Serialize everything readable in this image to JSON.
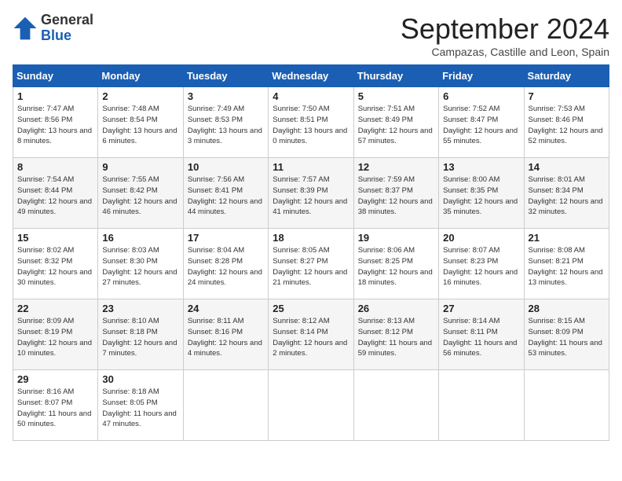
{
  "header": {
    "logo_general": "General",
    "logo_blue": "Blue",
    "month_title": "September 2024",
    "location": "Campazas, Castille and Leon, Spain"
  },
  "calendar": {
    "days_of_week": [
      "Sunday",
      "Monday",
      "Tuesday",
      "Wednesday",
      "Thursday",
      "Friday",
      "Saturday"
    ],
    "weeks": [
      [
        {
          "day": "1",
          "sunrise": "7:47 AM",
          "sunset": "8:56 PM",
          "daylight": "13 hours and 8 minutes."
        },
        {
          "day": "2",
          "sunrise": "7:48 AM",
          "sunset": "8:54 PM",
          "daylight": "13 hours and 6 minutes."
        },
        {
          "day": "3",
          "sunrise": "7:49 AM",
          "sunset": "8:53 PM",
          "daylight": "13 hours and 3 minutes."
        },
        {
          "day": "4",
          "sunrise": "7:50 AM",
          "sunset": "8:51 PM",
          "daylight": "13 hours and 0 minutes."
        },
        {
          "day": "5",
          "sunrise": "7:51 AM",
          "sunset": "8:49 PM",
          "daylight": "12 hours and 57 minutes."
        },
        {
          "day": "6",
          "sunrise": "7:52 AM",
          "sunset": "8:47 PM",
          "daylight": "12 hours and 55 minutes."
        },
        {
          "day": "7",
          "sunrise": "7:53 AM",
          "sunset": "8:46 PM",
          "daylight": "12 hours and 52 minutes."
        }
      ],
      [
        {
          "day": "8",
          "sunrise": "7:54 AM",
          "sunset": "8:44 PM",
          "daylight": "12 hours and 49 minutes."
        },
        {
          "day": "9",
          "sunrise": "7:55 AM",
          "sunset": "8:42 PM",
          "daylight": "12 hours and 46 minutes."
        },
        {
          "day": "10",
          "sunrise": "7:56 AM",
          "sunset": "8:41 PM",
          "daylight": "12 hours and 44 minutes."
        },
        {
          "day": "11",
          "sunrise": "7:57 AM",
          "sunset": "8:39 PM",
          "daylight": "12 hours and 41 minutes."
        },
        {
          "day": "12",
          "sunrise": "7:59 AM",
          "sunset": "8:37 PM",
          "daylight": "12 hours and 38 minutes."
        },
        {
          "day": "13",
          "sunrise": "8:00 AM",
          "sunset": "8:35 PM",
          "daylight": "12 hours and 35 minutes."
        },
        {
          "day": "14",
          "sunrise": "8:01 AM",
          "sunset": "8:34 PM",
          "daylight": "12 hours and 32 minutes."
        }
      ],
      [
        {
          "day": "15",
          "sunrise": "8:02 AM",
          "sunset": "8:32 PM",
          "daylight": "12 hours and 30 minutes."
        },
        {
          "day": "16",
          "sunrise": "8:03 AM",
          "sunset": "8:30 PM",
          "daylight": "12 hours and 27 minutes."
        },
        {
          "day": "17",
          "sunrise": "8:04 AM",
          "sunset": "8:28 PM",
          "daylight": "12 hours and 24 minutes."
        },
        {
          "day": "18",
          "sunrise": "8:05 AM",
          "sunset": "8:27 PM",
          "daylight": "12 hours and 21 minutes."
        },
        {
          "day": "19",
          "sunrise": "8:06 AM",
          "sunset": "8:25 PM",
          "daylight": "12 hours and 18 minutes."
        },
        {
          "day": "20",
          "sunrise": "8:07 AM",
          "sunset": "8:23 PM",
          "daylight": "12 hours and 16 minutes."
        },
        {
          "day": "21",
          "sunrise": "8:08 AM",
          "sunset": "8:21 PM",
          "daylight": "12 hours and 13 minutes."
        }
      ],
      [
        {
          "day": "22",
          "sunrise": "8:09 AM",
          "sunset": "8:19 PM",
          "daylight": "12 hours and 10 minutes."
        },
        {
          "day": "23",
          "sunrise": "8:10 AM",
          "sunset": "8:18 PM",
          "daylight": "12 hours and 7 minutes."
        },
        {
          "day": "24",
          "sunrise": "8:11 AM",
          "sunset": "8:16 PM",
          "daylight": "12 hours and 4 minutes."
        },
        {
          "day": "25",
          "sunrise": "8:12 AM",
          "sunset": "8:14 PM",
          "daylight": "12 hours and 2 minutes."
        },
        {
          "day": "26",
          "sunrise": "8:13 AM",
          "sunset": "8:12 PM",
          "daylight": "11 hours and 59 minutes."
        },
        {
          "day": "27",
          "sunrise": "8:14 AM",
          "sunset": "8:11 PM",
          "daylight": "11 hours and 56 minutes."
        },
        {
          "day": "28",
          "sunrise": "8:15 AM",
          "sunset": "8:09 PM",
          "daylight": "11 hours and 53 minutes."
        }
      ],
      [
        {
          "day": "29",
          "sunrise": "8:16 AM",
          "sunset": "8:07 PM",
          "daylight": "11 hours and 50 minutes."
        },
        {
          "day": "30",
          "sunrise": "8:18 AM",
          "sunset": "8:05 PM",
          "daylight": "11 hours and 47 minutes."
        },
        null,
        null,
        null,
        null,
        null
      ]
    ]
  }
}
